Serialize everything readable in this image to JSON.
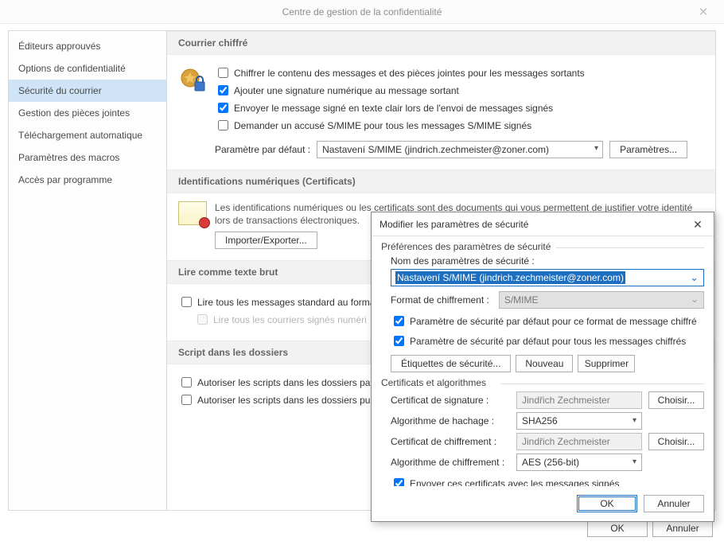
{
  "window": {
    "title": "Centre de gestion de la confidentialité"
  },
  "sidebar": {
    "items": [
      "Éditeurs approuvés",
      "Options de confidentialité",
      "Sécurité du courrier",
      "Gestion des pièces jointes",
      "Téléchargement automatique",
      "Paramètres des macros",
      "Accès par programme"
    ],
    "selected_index": 2
  },
  "sections": {
    "encrypted_mail": {
      "title": "Courrier chiffré",
      "opts": [
        {
          "label": "Chiffrer le contenu des messages et des pièces jointes pour les messages sortants",
          "checked": false
        },
        {
          "label": "Ajouter une signature numérique au message sortant",
          "checked": true
        },
        {
          "label": "Envoyer le message signé en texte clair lors de l'envoi de messages signés",
          "checked": true
        },
        {
          "label": "Demander un accusé S/MIME pour tous les messages S/MIME signés",
          "checked": false
        }
      ],
      "default_label": "Paramètre par défaut :",
      "default_value": "Nastavení S/MIME (jindrich.zechmeister@zoner.com)",
      "settings_btn": "Paramètres..."
    },
    "digital_ids": {
      "title": "Identifications numériques (Certificats)",
      "desc": "Les identifications numériques ou les certificats sont des documents qui vous permettent de justifier votre identité lors de transactions électroniques.",
      "import_btn": "Importer/Exporter..."
    },
    "plain_text": {
      "title": "Lire comme texte brut",
      "opt1": "Lire tous les messages standard au format",
      "opt2": "Lire tous les courriers signés numéri"
    },
    "script": {
      "title": "Script dans les dossiers",
      "opt1": "Autoriser les scripts dans les dossiers parta",
      "opt2": "Autoriser les scripts dans les dossiers publ"
    }
  },
  "buttons_main": {
    "ok": "OK",
    "cancel": "Annuler"
  },
  "modal": {
    "title": "Modifier les paramètres de sécurité",
    "group_prefs": "Préférences des paramètres de sécurité",
    "name_label": "Nom des paramètres de sécurité :",
    "name_value": "Nastavení S/MIME (jindrich.zechmeister@zoner.com)",
    "format_label": "Format de chiffrement :",
    "format_value": "S/MIME",
    "chk_default_format": "Paramètre de sécurité par défaut pour ce format de message chiffré",
    "chk_default_all": "Paramètre de sécurité par défaut pour tous les messages chiffrés",
    "btn_labels": "Étiquettes de sécurité...",
    "btn_new": "Nouveau",
    "btn_delete": "Supprimer",
    "group_certs": "Certificats et algorithmes",
    "sign_cert_label": "Certificat de signature :",
    "sign_cert_value": "Jindřich Zechmeister",
    "hash_algo_label": "Algorithme de hachage :",
    "hash_algo_value": "SHA256",
    "enc_cert_label": "Certificat de chiffrement :",
    "enc_cert_value": "Jindřich Zechmeister",
    "enc_algo_label": "Algorithme de chiffrement :",
    "enc_algo_value": "AES (256-bit)",
    "choose": "Choisir...",
    "chk_send_certs": "Envoyer ces certificats avec les messages signés",
    "ok": "OK",
    "cancel": "Annuler"
  }
}
